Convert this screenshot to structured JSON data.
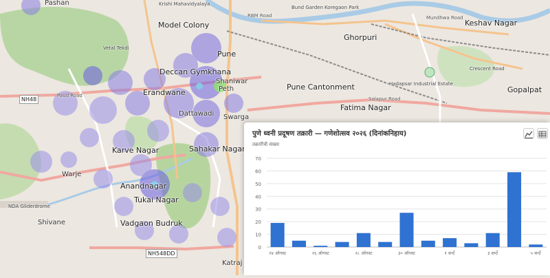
{
  "map": {
    "labels": {
      "pashan": "Pashan",
      "model_colony": "Model Colony",
      "pune": "Pune",
      "ghorpuri": "Ghorpuri",
      "keshav_nagar": "Keshav Nagar",
      "vetal_tekdi": "Vetal Tekdi",
      "deccan_gymkhana": "Deccan Gymkhana",
      "shaniwar": "Shaniwar",
      "peth": "Peth",
      "erandwane": "Erandwane",
      "pune_cantonment": "Pune Cantonment",
      "fatima_nagar": "Fatima Nagar",
      "gopalpatti": "Gopalpat",
      "dattawadi": "Dattawadi",
      "swargate": "Swarga",
      "karve_nagar": "Karve Nagar",
      "sahakar_nagar": "Sahakar Nagar",
      "warje": "Warje",
      "anandnagar": "Anandnagar",
      "tukai_nagar": "Tukai Nagar",
      "nda_gliderdrome": "NDA Gliderdrome",
      "shivane": "Shivane",
      "vadgaon_budruk": "Vadgaon Budruk",
      "katraj": "Katraj",
      "hadapsar": "Hadapsar Industrial Estate",
      "krishi": "Krishi Mahavidyalaya",
      "koregaon": "Koregaon Park",
      "bund_garden": "Bund Garden",
      "rbm_road": "RBM Road",
      "mundhwa_road": "Mundhwa Road",
      "solapur_road": "Solapur Road",
      "paud_road": "Paud Road",
      "crescent_road": "Crescent Road"
    },
    "shields": {
      "nh48": "NH48",
      "nh548dd": "NH548DD"
    }
  },
  "panel": {
    "title": "पुणे ध्वनी प्रदूषण तक्रारी — गणेशोत्सव २०२६ (दिनांकनिहाय)",
    "subtitle": "तक्रारींची संख्या",
    "tool_icons": [
      "line-chart-icon",
      "table-icon"
    ]
  },
  "chart_data": {
    "type": "bar",
    "ylabel": "तक्रारींची संख्या",
    "ylim": [
      0,
      70
    ],
    "yticks": [
      0,
      10,
      20,
      30,
      40,
      50,
      60,
      70
    ],
    "grid": true,
    "bar_color": "#2f72d1",
    "values": [
      19,
      5,
      1,
      4,
      11,
      4,
      27,
      5,
      7,
      3,
      11,
      59,
      2
    ],
    "tick_labels": [
      {
        "index": 0,
        "label": "२४ ऑगस्ट"
      },
      {
        "index": 2,
        "label": "२६ ऑगस्ट"
      },
      {
        "index": 4,
        "label": "२८ ऑगस्ट"
      },
      {
        "index": 6,
        "label": "३० ऑगस्ट"
      },
      {
        "index": 8,
        "label": "१ सप्टें"
      },
      {
        "index": 10,
        "label": "३ सप्टें"
      },
      {
        "index": 12,
        "label": "५ सप्टें"
      }
    ]
  }
}
